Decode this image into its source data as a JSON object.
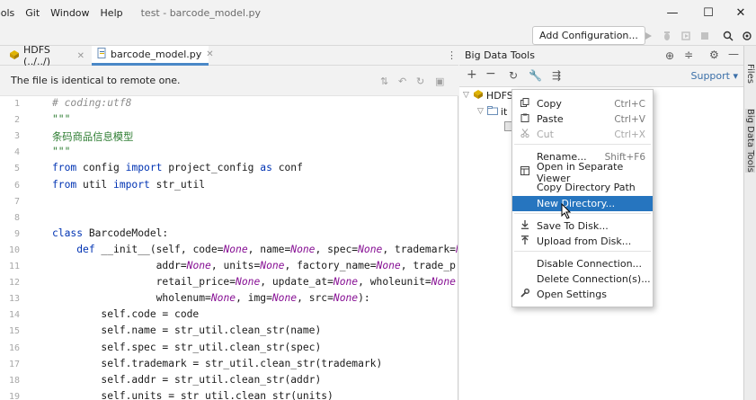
{
  "menubar": {
    "items": [
      "ools",
      "Git",
      "Window",
      "Help"
    ],
    "title": "test - barcode_model.py"
  },
  "window_controls": {
    "minimize": "—",
    "maximize": "☐",
    "close": "✕"
  },
  "toolbar": {
    "add_configuration": "Add Configuration..."
  },
  "tabs": [
    {
      "label": "HDFS (../../)",
      "active": false
    },
    {
      "label": "barcode_model.py",
      "active": true
    }
  ],
  "notice": {
    "text": "The file is identical to remote one."
  },
  "editor": {
    "lines": [
      {
        "n": "1",
        "tokens": [
          {
            "t": "# coding:utf8",
            "c": "cm"
          }
        ]
      },
      {
        "n": "2",
        "tokens": [
          {
            "t": "\"\"\"",
            "c": "str"
          }
        ]
      },
      {
        "n": "3",
        "tokens": [
          {
            "t": "条码商品信息模型",
            "c": "str"
          }
        ]
      },
      {
        "n": "4",
        "tokens": [
          {
            "t": "\"\"\"",
            "c": "str"
          }
        ]
      },
      {
        "n": "5",
        "tokens": [
          {
            "t": "from",
            "c": "kw"
          },
          {
            "t": " config ",
            "c": ""
          },
          {
            "t": "import",
            "c": "kw"
          },
          {
            "t": " project_config ",
            "c": ""
          },
          {
            "t": "as",
            "c": "kw"
          },
          {
            "t": " conf",
            "c": ""
          }
        ]
      },
      {
        "n": "6",
        "tokens": [
          {
            "t": "from",
            "c": "kw"
          },
          {
            "t": " util ",
            "c": ""
          },
          {
            "t": "import",
            "c": "kw"
          },
          {
            "t": " str_util",
            "c": ""
          }
        ]
      },
      {
        "n": "7",
        "tokens": []
      },
      {
        "n": "8",
        "tokens": []
      },
      {
        "n": "9",
        "tokens": [
          {
            "t": "class",
            "c": "kw"
          },
          {
            "t": " BarcodeModel:",
            "c": ""
          }
        ]
      },
      {
        "n": "10",
        "tokens": [
          {
            "t": "    ",
            "c": ""
          },
          {
            "t": "def",
            "c": "kw"
          },
          {
            "t": " __init__(self, code=",
            "c": ""
          },
          {
            "t": "None",
            "c": "none"
          },
          {
            "t": ", name=",
            "c": ""
          },
          {
            "t": "None",
            "c": "none"
          },
          {
            "t": ", spec=",
            "c": ""
          },
          {
            "t": "None",
            "c": "none"
          },
          {
            "t": ", trademark=",
            "c": ""
          },
          {
            "t": "Non",
            "c": "none"
          }
        ]
      },
      {
        "n": "11",
        "tokens": [
          {
            "t": "                 addr=",
            "c": ""
          },
          {
            "t": "None",
            "c": "none"
          },
          {
            "t": ", units=",
            "c": ""
          },
          {
            "t": "None",
            "c": "none"
          },
          {
            "t": ", factory_name=",
            "c": ""
          },
          {
            "t": "None",
            "c": "none"
          },
          {
            "t": ", trade_pric",
            "c": ""
          }
        ]
      },
      {
        "n": "12",
        "tokens": [
          {
            "t": "                 retail_price=",
            "c": ""
          },
          {
            "t": "None",
            "c": "none"
          },
          {
            "t": ", update_at=",
            "c": ""
          },
          {
            "t": "None",
            "c": "none"
          },
          {
            "t": ", wholeunit=",
            "c": ""
          },
          {
            "t": "None",
            "c": "none"
          },
          {
            "t": ",",
            "c": ""
          }
        ]
      },
      {
        "n": "13",
        "tokens": [
          {
            "t": "                 wholenum=",
            "c": ""
          },
          {
            "t": "None",
            "c": "none"
          },
          {
            "t": ", img=",
            "c": ""
          },
          {
            "t": "None",
            "c": "none"
          },
          {
            "t": ", src=",
            "c": ""
          },
          {
            "t": "None",
            "c": "none"
          },
          {
            "t": "):",
            "c": ""
          }
        ]
      },
      {
        "n": "14",
        "tokens": [
          {
            "t": "        self.code = code",
            "c": ""
          }
        ]
      },
      {
        "n": "15",
        "tokens": [
          {
            "t": "        self.name = str_util.clean_str(name)",
            "c": ""
          }
        ]
      },
      {
        "n": "16",
        "tokens": [
          {
            "t": "        self.spec = str_util.clean_str(spec)",
            "c": ""
          }
        ]
      },
      {
        "n": "17",
        "tokens": [
          {
            "t": "        self.trademark = str_util.clean_str(trademark)",
            "c": ""
          }
        ]
      },
      {
        "n": "18",
        "tokens": [
          {
            "t": "        self.addr = str_util.clean_str(addr)",
            "c": ""
          }
        ]
      },
      {
        "n": "19",
        "tokens": [
          {
            "t": "        self.units = str_util.clean_str(units)",
            "c": ""
          }
        ]
      }
    ]
  },
  "bdt": {
    "title": "Big Data Tools",
    "support": "Support",
    "tree": [
      {
        "label": "HDFS"
      },
      {
        "label": "it"
      }
    ]
  },
  "right_strip": {
    "files": "Files",
    "bdt": "Big Data Tools"
  },
  "context_menu": {
    "items": [
      {
        "label": "Copy",
        "shortcut": "Ctrl+C",
        "icon": "copy-icon",
        "disabled": false,
        "highlighted": false
      },
      {
        "label": "Paste",
        "shortcut": "Ctrl+V",
        "icon": "paste-icon",
        "disabled": false,
        "highlighted": false
      },
      {
        "label": "Cut",
        "shortcut": "Ctrl+X",
        "icon": "cut-icon",
        "disabled": true,
        "highlighted": false
      },
      {
        "label": "Rename...",
        "shortcut": "Shift+F6",
        "icon": "",
        "disabled": false,
        "highlighted": false
      },
      {
        "label": "Open in Separate Viewer",
        "shortcut": "",
        "icon": "viewer-icon",
        "disabled": false,
        "highlighted": false
      },
      {
        "label": "Copy Directory Path",
        "shortcut": "",
        "icon": "",
        "disabled": false,
        "highlighted": false
      },
      {
        "label": "New Directory...",
        "shortcut": "",
        "icon": "",
        "disabled": false,
        "highlighted": true
      },
      {
        "label": "Save To Disk...",
        "shortcut": "",
        "icon": "download-icon",
        "disabled": false,
        "highlighted": false
      },
      {
        "label": "Upload from Disk...",
        "shortcut": "",
        "icon": "upload-icon",
        "disabled": false,
        "highlighted": false
      },
      {
        "label": "Disable Connection...",
        "shortcut": "",
        "icon": "",
        "disabled": false,
        "highlighted": false
      },
      {
        "label": "Delete Connection(s)...",
        "shortcut": "",
        "icon": "",
        "disabled": false,
        "highlighted": false
      },
      {
        "label": "Open Settings",
        "shortcut": "",
        "icon": "wrench-icon",
        "disabled": false,
        "highlighted": false
      }
    ]
  },
  "colors": {
    "accent": "#2675bf",
    "tab_underline": "#4a88c7",
    "keyword": "#0033b3",
    "string": "#2e7d32",
    "comment": "#8c8c8c",
    "none_kw": "#871094"
  }
}
